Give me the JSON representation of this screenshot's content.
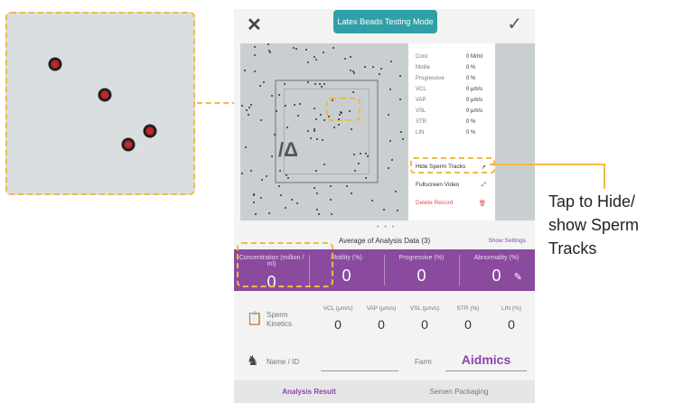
{
  "topbar": {
    "mode_label": "Latex Beads Testing Mode"
  },
  "panel": {
    "metrics": [
      {
        "name": "Conc",
        "value": "0 M/ml"
      },
      {
        "name": "Motile",
        "value": "0 %"
      },
      {
        "name": "Progressive",
        "value": "0 %"
      },
      {
        "name": "VCL",
        "value": "0 μm/s"
      },
      {
        "name": "VAP",
        "value": "0 μm/s"
      },
      {
        "name": "VSL",
        "value": "0 μm/s"
      },
      {
        "name": "STR",
        "value": "0 %"
      },
      {
        "name": "LIN",
        "value": "0 %"
      }
    ],
    "hide_tracks": "Hide Sperm Tracks",
    "fullscreen": "Fullscreen Video",
    "delete": "Delete Record"
  },
  "pager": "• • •",
  "summary": {
    "title": "Average of Analysis Data (3)",
    "settings": "Show Settings",
    "stats": [
      {
        "label": "Concentration (million / ml)",
        "value": "0"
      },
      {
        "label": "Motility (%)",
        "value": "0"
      },
      {
        "label": "Progressive (%)",
        "value": "0"
      },
      {
        "label": "Abnormality (%)",
        "value": "0"
      }
    ]
  },
  "kinetics": {
    "title_line1": "Sperm",
    "title_line2": "Kinetics",
    "cols": [
      {
        "label": "VCL (μm/s)",
        "value": "0"
      },
      {
        "label": "VAP (μm/s)",
        "value": "0"
      },
      {
        "label": "VSL (μm/s)",
        "value": "0"
      },
      {
        "label": "STR (%)",
        "value": "0"
      },
      {
        "label": "LIN (%)",
        "value": "0"
      }
    ]
  },
  "form": {
    "name_label": "Name / ID",
    "farm_label": "Farm",
    "farm_value": "Aidmics"
  },
  "tabs": [
    "Analysis Result",
    "Semen Packaging"
  ],
  "callout": "Tap to Hide/ show Sperm Tracks",
  "icons": {
    "close": "close-icon",
    "check": "check-icon",
    "tracks": "tracks-icon",
    "fullscreen": "fullscreen-icon",
    "trash": "trash-icon",
    "edit": "pencil-icon",
    "doc": "clipboard-icon",
    "horse": "horse-icon"
  },
  "colors": {
    "accent": "#8a4a9e",
    "teal": "#2fa0a8",
    "highlight": "#f2b944",
    "danger": "#d9534f"
  }
}
